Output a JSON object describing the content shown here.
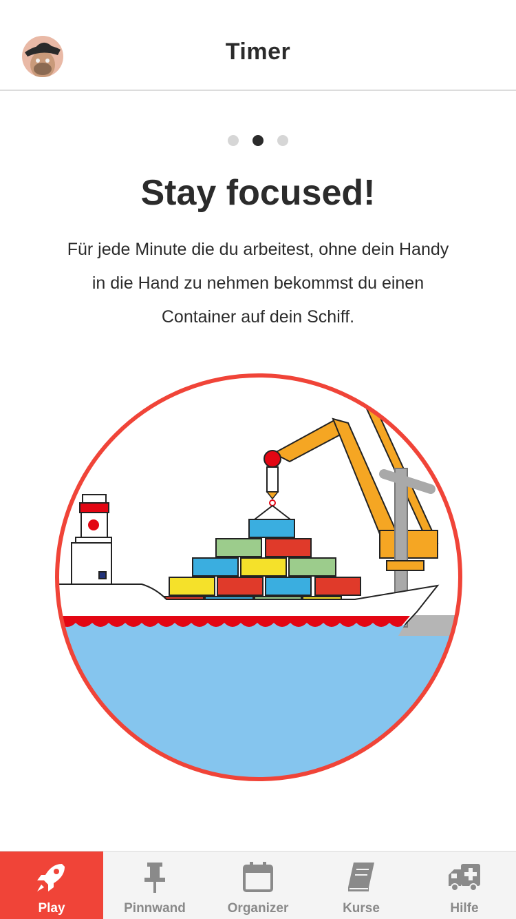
{
  "header": {
    "title": "Timer"
  },
  "pager": {
    "count": 3,
    "active_index": 1
  },
  "intro": {
    "headline": "Stay focused!",
    "lines": [
      "Für jede Minute die du arbeitest, ohne dein Handy",
      "in die Hand zu nehmen bekommst du einen",
      "Container auf dein Schiff."
    ]
  },
  "colors": {
    "accent": "#f04438",
    "sea": "#85c5ee",
    "tab_inactive": "#8a8a8a",
    "crane": "#f5a623",
    "hull_red": "#e30613"
  },
  "tabs": [
    {
      "label": "Play",
      "icon": "rocket-icon",
      "active": true
    },
    {
      "label": "Pinnwand",
      "icon": "pushpin-icon",
      "active": false
    },
    {
      "label": "Organizer",
      "icon": "calendar-icon",
      "active": false
    },
    {
      "label": "Kurse",
      "icon": "book-icon",
      "active": false
    },
    {
      "label": "Hilfe",
      "icon": "ambulance-icon",
      "active": false
    }
  ]
}
